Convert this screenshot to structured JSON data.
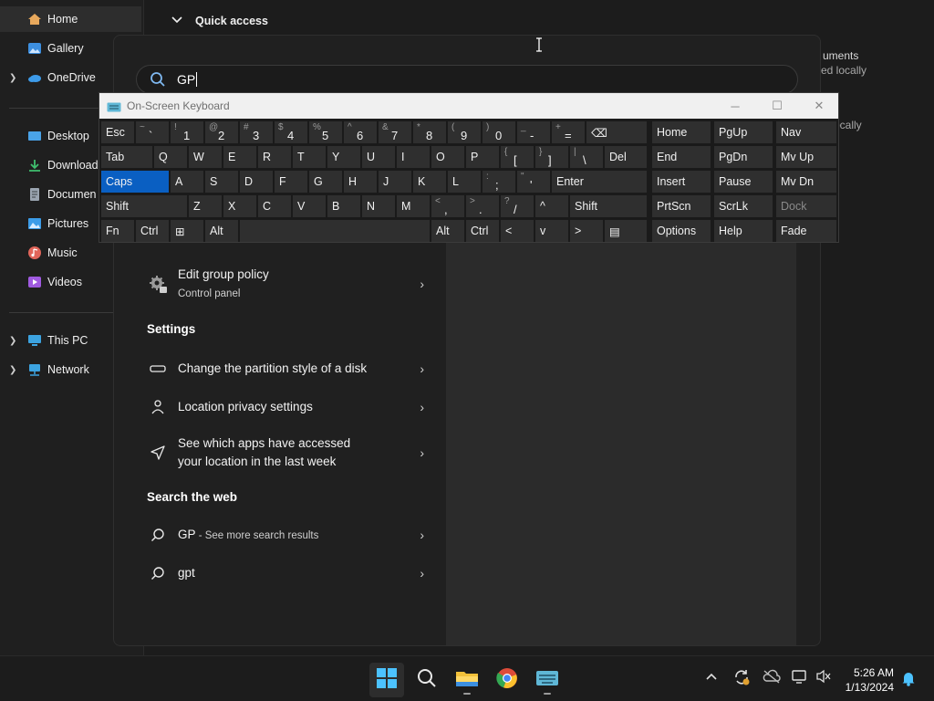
{
  "nav": {
    "items": [
      {
        "label": "Home",
        "icon": "home-icon",
        "color": "#e8a85c"
      },
      {
        "label": "Gallery",
        "icon": "gallery-icon",
        "color": "#3d8fe0"
      },
      {
        "label": "OneDrive",
        "icon": "cloud-icon",
        "color": "#3d9be9"
      },
      {
        "label": "Desktop",
        "icon": "desktop-icon",
        "color": "#4aa3e8"
      },
      {
        "label": "Download",
        "icon": "download-icon",
        "color": "#3fbf6e"
      },
      {
        "label": "Documen",
        "icon": "documents-icon",
        "color": "#9aa4b0"
      },
      {
        "label": "Pictures",
        "icon": "pictures-icon",
        "color": "#3c9ce8"
      },
      {
        "label": "Music",
        "icon": "music-icon",
        "color": "#e0655a"
      },
      {
        "label": "Videos",
        "icon": "videos-icon",
        "color": "#a05ae0"
      },
      {
        "label": "This PC",
        "icon": "pc-icon",
        "color": "#3ca3e0"
      },
      {
        "label": "Network",
        "icon": "network-icon",
        "color": "#3ca3e0"
      }
    ]
  },
  "explorer": {
    "quick_access": "Quick access",
    "frag1": "uments",
    "frag2": "ed locally",
    "frag3": "ocally"
  },
  "search": {
    "query": "GP"
  },
  "results": {
    "top_item": {
      "title": "Edit group policy",
      "subtitle": "Control panel"
    },
    "settings_heading": "Settings",
    "settings": [
      {
        "title": "Change the partition style of a disk",
        "icon": "disk-icon"
      },
      {
        "title": "Location privacy settings",
        "icon": "person-location-icon"
      },
      {
        "title_line1": "See which apps have accessed",
        "title_line2": "your location in the last week",
        "icon": "location-arrow-icon"
      }
    ],
    "web_heading": "Search the web",
    "web": [
      {
        "title": "GP",
        "suffix": " - See more search results"
      },
      {
        "title": "gpt"
      }
    ]
  },
  "osk": {
    "title": "On-Screen Keyboard",
    "controls": {
      "minimize": "─",
      "maximize": "☐",
      "close": "✕"
    },
    "rows": [
      [
        {
          "main": "Esc"
        },
        {
          "sec": "~",
          "pri": "`"
        },
        {
          "sec": "!",
          "pri": "1"
        },
        {
          "sec": "@",
          "pri": "2"
        },
        {
          "sec": "#",
          "pri": "3"
        },
        {
          "sec": "$",
          "pri": "4"
        },
        {
          "sec": "%",
          "pri": "5"
        },
        {
          "sec": "^",
          "pri": "6"
        },
        {
          "sec": "&",
          "pri": "7"
        },
        {
          "sec": "*",
          "pri": "8"
        },
        {
          "sec": "(",
          "pri": "9"
        },
        {
          "sec": ")",
          "pri": "0"
        },
        {
          "sec": "_",
          "pri": "-"
        },
        {
          "sec": "+",
          "pri": "="
        },
        {
          "main": "⌫"
        }
      ],
      [
        {
          "main": "Tab"
        },
        {
          "main": "Q"
        },
        {
          "main": "W"
        },
        {
          "main": "E"
        },
        {
          "main": "R"
        },
        {
          "main": "T"
        },
        {
          "main": "Y"
        },
        {
          "main": "U"
        },
        {
          "main": "I"
        },
        {
          "main": "O"
        },
        {
          "main": "P"
        },
        {
          "sec": "{",
          "pri": "["
        },
        {
          "sec": "}",
          "pri": "]"
        },
        {
          "sec": "|",
          "pri": "\\"
        },
        {
          "main": "Del"
        }
      ],
      [
        {
          "main": "Caps"
        },
        {
          "main": "A"
        },
        {
          "main": "S"
        },
        {
          "main": "D"
        },
        {
          "main": "F"
        },
        {
          "main": "G"
        },
        {
          "main": "H"
        },
        {
          "main": "J"
        },
        {
          "main": "K"
        },
        {
          "main": "L"
        },
        {
          "sec": ":",
          "pri": ";"
        },
        {
          "sec": "\"",
          "pri": "'"
        },
        {
          "main": "Enter"
        }
      ],
      [
        {
          "main": "Shift"
        },
        {
          "main": "Z"
        },
        {
          "main": "X"
        },
        {
          "main": "C"
        },
        {
          "main": "V"
        },
        {
          "main": "B"
        },
        {
          "main": "N"
        },
        {
          "main": "M"
        },
        {
          "sec": "<",
          "pri": ","
        },
        {
          "sec": ">",
          "pri": "."
        },
        {
          "sec": "?",
          "pri": "/"
        },
        {
          "main": "^"
        },
        {
          "main": "Shift"
        }
      ],
      [
        {
          "main": "Fn"
        },
        {
          "main": "Ctrl"
        },
        {
          "main": "⊞"
        },
        {
          "main": "Alt"
        },
        {
          "main": ""
        },
        {
          "main": "Alt"
        },
        {
          "main": "Ctrl"
        },
        {
          "main": "<"
        },
        {
          "main": "v"
        },
        {
          "main": ">"
        },
        {
          "main": "▤"
        }
      ]
    ],
    "side_keys": [
      [
        "Home",
        "PgUp",
        "Nav"
      ],
      [
        "End",
        "PgDn",
        "Mv Up"
      ],
      [
        "Insert",
        "Pause",
        "Mv Dn"
      ],
      [
        "PrtScn",
        "ScrLk",
        "Dock"
      ],
      [
        "Options",
        "Help",
        "Fade"
      ]
    ]
  },
  "taskbar": {
    "time": "5:26 AM",
    "date": "1/13/2024",
    "apps": [
      "start-icon",
      "search-icon",
      "file-explorer-icon",
      "chrome-icon",
      "on-screen-keyboard-icon"
    ]
  }
}
